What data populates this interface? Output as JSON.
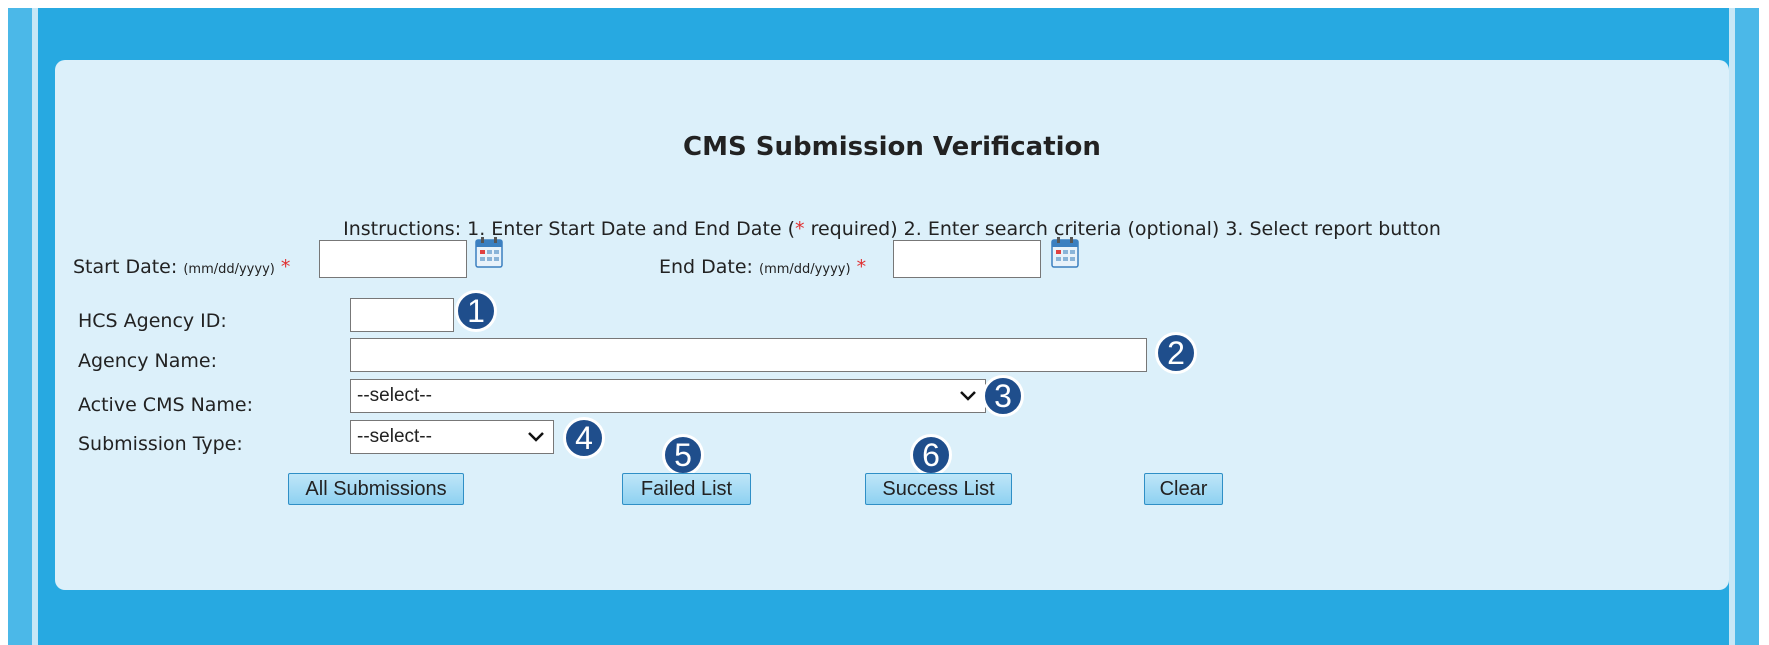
{
  "page": {
    "title": "CMS Submission Verification",
    "instructions_before": "Instructions: 1. Enter Start Date and End Date (",
    "instructions_req": "*",
    "instructions_after": " required) 2. Enter search criteria (optional) 3. Select report button"
  },
  "dates": {
    "start_label": "Start Date:",
    "start_format": "(mm/dd/yyyy)",
    "end_label": "End Date:",
    "end_format": "(mm/dd/yyyy)",
    "required_mark": "*",
    "start_value": "",
    "end_value": ""
  },
  "criteria": {
    "hcs_agency_id_label": "HCS Agency ID:",
    "hcs_agency_id_value": "",
    "agency_name_label": "Agency Name:",
    "agency_name_value": "",
    "active_cms_label": "Active CMS Name:",
    "active_cms_selected": "--select--",
    "submission_type_label": "Submission Type:",
    "submission_type_selected": "--select--"
  },
  "callouts": [
    "1",
    "2",
    "3",
    "4",
    "5",
    "6"
  ],
  "buttons": {
    "all_submissions": "All Submissions",
    "failed_list": "Failed List",
    "success_list": "Success List",
    "clear": "Clear"
  },
  "colors": {
    "background": "#27a9e1",
    "panel": "#dcf0fa",
    "callout": "#1f4e8c",
    "required": "#e03030"
  },
  "icons": {
    "calendar": "calendar-icon",
    "dropdown": "chevron-down-icon"
  }
}
